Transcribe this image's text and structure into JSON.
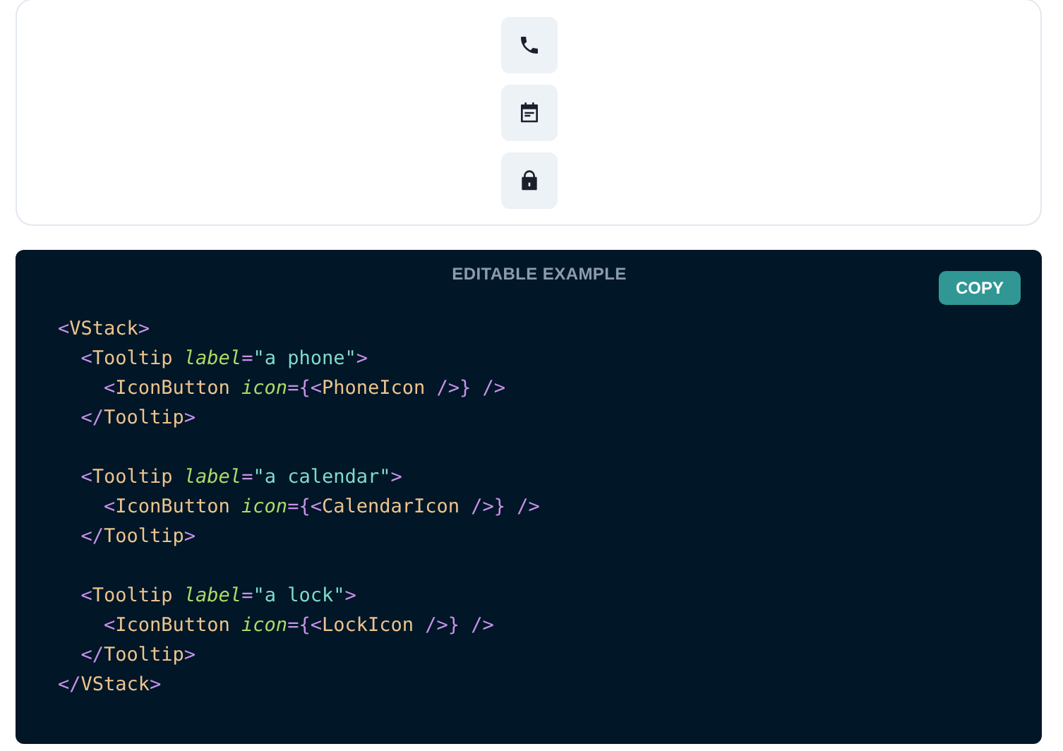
{
  "code_block": {
    "heading": "EDITABLE EXAMPLE",
    "copy_button": "COPY",
    "paragraphs": [
      {
        "lines": [
          [
            {
              "kind": "punct",
              "text": "<"
            },
            {
              "kind": "tag",
              "text": "VStack"
            },
            {
              "kind": "punct",
              "text": ">"
            }
          ],
          [
            {
              "kind": "punct",
              "text": "  <"
            },
            {
              "kind": "tag",
              "text": "Tooltip "
            },
            {
              "kind": "attr",
              "text": "label"
            },
            {
              "kind": "punct",
              "text": "="
            },
            {
              "kind": "string",
              "text": "\"a phone\""
            },
            {
              "kind": "punct",
              "text": ">"
            }
          ],
          [
            {
              "kind": "punct",
              "text": "    <"
            },
            {
              "kind": "tag",
              "text": "IconButton "
            },
            {
              "kind": "attr",
              "text": "icon"
            },
            {
              "kind": "punct",
              "text": "={<"
            },
            {
              "kind": "tag",
              "text": "PhoneIcon "
            },
            {
              "kind": "punct",
              "text": "/>} />"
            }
          ],
          [
            {
              "kind": "punct",
              "text": "  </"
            },
            {
              "kind": "tag",
              "text": "Tooltip"
            },
            {
              "kind": "punct",
              "text": ">"
            }
          ]
        ]
      },
      {
        "lines": [
          [
            {
              "kind": "punct",
              "text": "  <"
            },
            {
              "kind": "tag",
              "text": "Tooltip "
            },
            {
              "kind": "attr",
              "text": "label"
            },
            {
              "kind": "punct",
              "text": "="
            },
            {
              "kind": "string",
              "text": "\"a calendar\""
            },
            {
              "kind": "punct",
              "text": ">"
            }
          ],
          [
            {
              "kind": "punct",
              "text": "    <"
            },
            {
              "kind": "tag",
              "text": "IconButton "
            },
            {
              "kind": "attr",
              "text": "icon"
            },
            {
              "kind": "punct",
              "text": "={<"
            },
            {
              "kind": "tag",
              "text": "CalendarIcon "
            },
            {
              "kind": "punct",
              "text": "/>} />"
            }
          ],
          [
            {
              "kind": "punct",
              "text": "  </"
            },
            {
              "kind": "tag",
              "text": "Tooltip"
            },
            {
              "kind": "punct",
              "text": ">"
            }
          ]
        ]
      },
      {
        "lines": [
          [
            {
              "kind": "punct",
              "text": "  <"
            },
            {
              "kind": "tag",
              "text": "Tooltip "
            },
            {
              "kind": "attr",
              "text": "label"
            },
            {
              "kind": "punct",
              "text": "="
            },
            {
              "kind": "string",
              "text": "\"a lock\""
            },
            {
              "kind": "punct",
              "text": ">"
            }
          ],
          [
            {
              "kind": "punct",
              "text": "    <"
            },
            {
              "kind": "tag",
              "text": "IconButton "
            },
            {
              "kind": "attr",
              "text": "icon"
            },
            {
              "kind": "punct",
              "text": "={<"
            },
            {
              "kind": "tag",
              "text": "LockIcon "
            },
            {
              "kind": "punct",
              "text": "/>} />"
            }
          ],
          [
            {
              "kind": "punct",
              "text": "  </"
            },
            {
              "kind": "tag",
              "text": "Tooltip"
            },
            {
              "kind": "punct",
              "text": ">"
            }
          ],
          [
            {
              "kind": "punct",
              "text": "</"
            },
            {
              "kind": "tag",
              "text": "VStack"
            },
            {
              "kind": "punct",
              "text": ">"
            }
          ]
        ]
      }
    ]
  }
}
